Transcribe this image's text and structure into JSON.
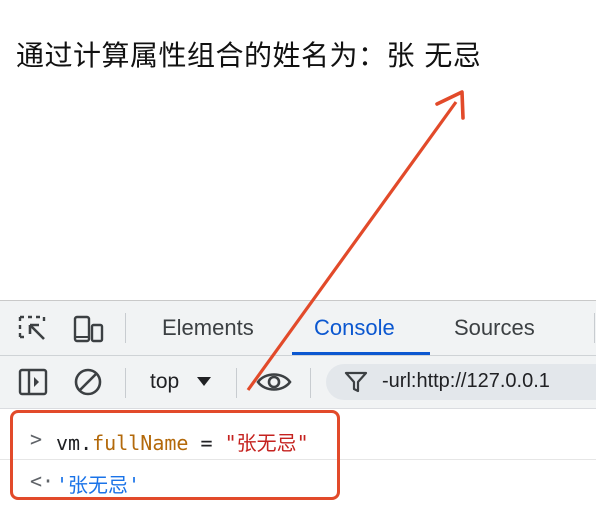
{
  "page": {
    "heading": "通过计算属性组合的姓名为：张 无忌"
  },
  "devtools": {
    "tabs": [
      {
        "label": "Elements",
        "active": false
      },
      {
        "label": "Console",
        "active": true
      },
      {
        "label": "Sources",
        "active": false
      }
    ],
    "toolbar": {
      "context": "top",
      "filter_value": "-url:http://127.0.0.1"
    },
    "console": {
      "input": {
        "object": "vm",
        "dot": ".",
        "property": "fullName",
        "operator": " = ",
        "value": "\"张无忌\""
      },
      "result": "'张无忌'"
    }
  },
  "annotation": {
    "color": "#e24a2a"
  },
  "colors": {
    "accent": "#0b57d0",
    "string": "#c5221f",
    "property": "#b3690a",
    "result": "#1a73e8"
  }
}
